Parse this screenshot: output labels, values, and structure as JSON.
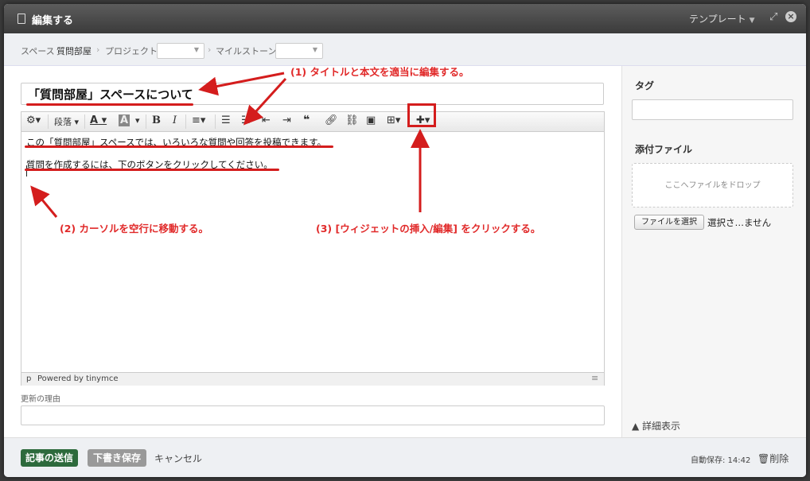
{
  "dialog": {
    "title": "編集する",
    "template_label": "テンプレート",
    "close_glyph": "×",
    "expand_glyph": "⤢"
  },
  "breadcrumb": {
    "space_label": "スペース",
    "space_name": "質問部屋",
    "project_label": "プロジェクト",
    "milestone_label": "マイルストーン"
  },
  "editor": {
    "title_value": "「質問部屋」スペースについて",
    "toolbar": {
      "settings_icon": "gear-icon",
      "format_label": "段落",
      "text_color": "A",
      "bg_color": "A",
      "bold": "B",
      "italic": "I"
    },
    "body_lines": [
      "この「質問部屋」スペースでは、いろいろな質問や回答を投稿できます。",
      "質問を作成するには、下のボタンをクリックしてください。"
    ],
    "status_path": "p",
    "status_powered": "Powered by tinymce"
  },
  "reason": {
    "label": "更新の理由",
    "value": ""
  },
  "sidebar": {
    "tag_label": "タグ",
    "tag_value": "",
    "attach_label": "添付ファイル",
    "drop_text": "ここへファイルをドロップ",
    "file_button": "ファイルを選択",
    "file_status": "選択さ…ません",
    "detail_toggle": "▲ 詳細表示"
  },
  "footer": {
    "send": "記事の送信",
    "draft": "下書き保存",
    "cancel": "キャンセル",
    "autosave": "自動保存: 14:42",
    "delete": "削除"
  },
  "annotations": {
    "step1": "(1) タイトルと本文を適当に編集する。",
    "step2": "(2) カーソルを空行に移動する。",
    "step3": "(3) [ウィジェットの挿入/編集] をクリックする。",
    "color": "#d41d1d"
  }
}
